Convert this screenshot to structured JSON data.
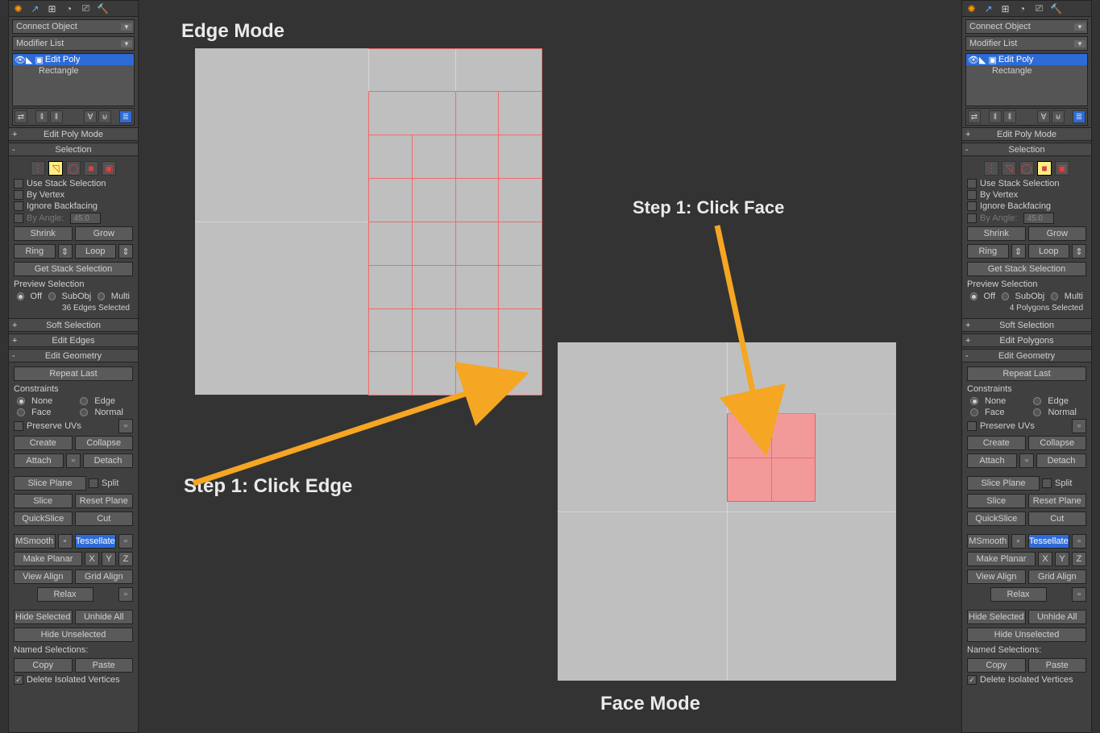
{
  "titles": {
    "edge_mode": "Edge Mode",
    "face_mode": "Face Mode",
    "step_edge": "Step 1: Click Edge",
    "step_face": "Step 1: Click Face"
  },
  "panel": {
    "connect_object": "Connect Object",
    "modifier_list": "Modifier List",
    "stack": {
      "edit_poly": "Edit Poly",
      "rectangle": "Rectangle"
    },
    "rollouts": {
      "edit_poly_mode": "Edit Poly Mode",
      "selection": "Selection",
      "soft_selection": "Soft Selection",
      "edit_edges": "Edit Edges",
      "edit_polygons": "Edit Polygons",
      "edit_geometry": "Edit Geometry"
    },
    "selection": {
      "use_stack": "Use Stack Selection",
      "by_vertex": "By Vertex",
      "ignore_backfacing": "Ignore Backfacing",
      "by_angle": "By Angle:",
      "by_angle_val": "45.0",
      "shrink": "Shrink",
      "grow": "Grow",
      "ring": "Ring",
      "loop": "Loop",
      "get_stack_sel": "Get Stack Selection",
      "preview_selection": "Preview Selection",
      "off": "Off",
      "subobj": "SubObj",
      "multi": "Multi",
      "edges_selected": "36 Edges Selected",
      "polys_selected": "4 Polygons Selected"
    },
    "geom": {
      "repeat_last": "Repeat Last",
      "constraints": "Constraints",
      "none": "None",
      "edge": "Edge",
      "face": "Face",
      "normal": "Normal",
      "preserve_uvs": "Preserve UVs",
      "create": "Create",
      "collapse": "Collapse",
      "attach": "Attach",
      "detach": "Detach",
      "slice_plane": "Slice Plane",
      "split": "Split",
      "slice": "Slice",
      "reset_plane": "Reset Plane",
      "quickslice": "QuickSlice",
      "cut": "Cut",
      "msmooth": "MSmooth",
      "tessellate": "Tessellate",
      "make_planar": "Make Planar",
      "x": "X",
      "y": "Y",
      "z": "Z",
      "view_align": "View Align",
      "grid_align": "Grid Align",
      "relax": "Relax",
      "hide_selected": "Hide Selected",
      "unhide_all": "Unhide All",
      "hide_unselected": "Hide Unselected",
      "named_selections": "Named Selections:",
      "copy": "Copy",
      "paste": "Paste",
      "delete_iso": "Delete Isolated Vertices"
    }
  }
}
